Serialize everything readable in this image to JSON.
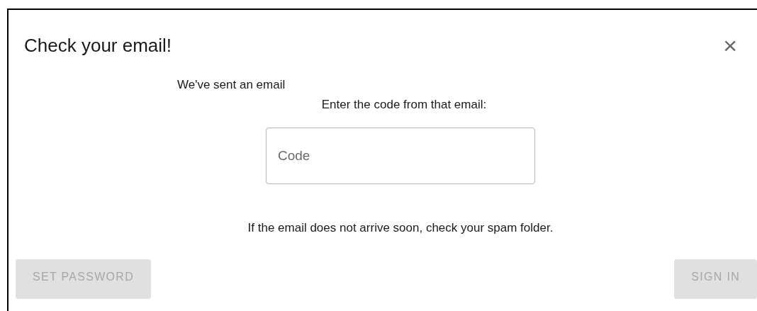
{
  "dialog": {
    "title": "Check your email!",
    "close_icon": "×"
  },
  "sent_text": "We've sent an email",
  "instruction": "Enter the code from that email:",
  "code_field": {
    "placeholder": "Code"
  },
  "spam_hint": "If the email does not arrive soon, check your spam folder.",
  "buttons": [
    {
      "label": "SET PASSWORD",
      "disabled": true
    },
    {
      "label": "SIGN IN",
      "disabled": true
    }
  ]
}
